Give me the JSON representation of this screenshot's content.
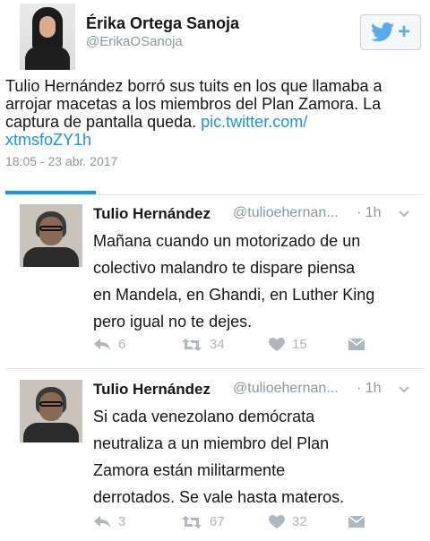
{
  "main_tweet": {
    "author_name": "Érika Ortega Sanoja",
    "author_handle": "@ErikaOSanoja",
    "follow_plus": "+",
    "text_lines": [
      "Tulio Hernández borró sus tuits en los que llamaba a",
      "arrojar macetas a los miembros del Plan Zamora. La",
      "captura de pantalla queda. "
    ],
    "link_part1": "pic.twitter.com/",
    "link_part2": "xtmsfoZY1h",
    "timestamp": "18:05 - 23 abr. 2017"
  },
  "embedded_tweets": [
    {
      "name": "Tulio Hernández",
      "handle": "@tulioehernan...",
      "time": "· 1h",
      "lines": [
        "Mañana cuando un motorizado de un",
        "colectivo malandro  te dispare piensa",
        "en Mandela, en Ghandi, en Luther King",
        "pero igual no te dejes."
      ],
      "replies": "6",
      "retweets": "34",
      "likes": "15"
    },
    {
      "name": "Tulio Hernández",
      "handle": "@tulioehernan...",
      "time": "· 1h",
      "lines": [
        "Si cada venezolano demócrata",
        "neutraliza a un miembro del Plan",
        "Zamora están militarmente",
        "derrotados. Se vale hasta materos."
      ],
      "replies": "3",
      "retweets": "67",
      "likes": "32"
    }
  ],
  "icons": {
    "follow": "twitter-bird-icon",
    "reply": "reply-icon",
    "retweet": "retweet-icon",
    "like": "heart-icon",
    "dm": "direct-message-icon",
    "more": "chevron-down-icon"
  },
  "colors": {
    "link": "#1b95e0",
    "brand": "#55acee",
    "muted": "#8899a6",
    "action": "#aab8c2",
    "divider": "#e1e8ed"
  }
}
